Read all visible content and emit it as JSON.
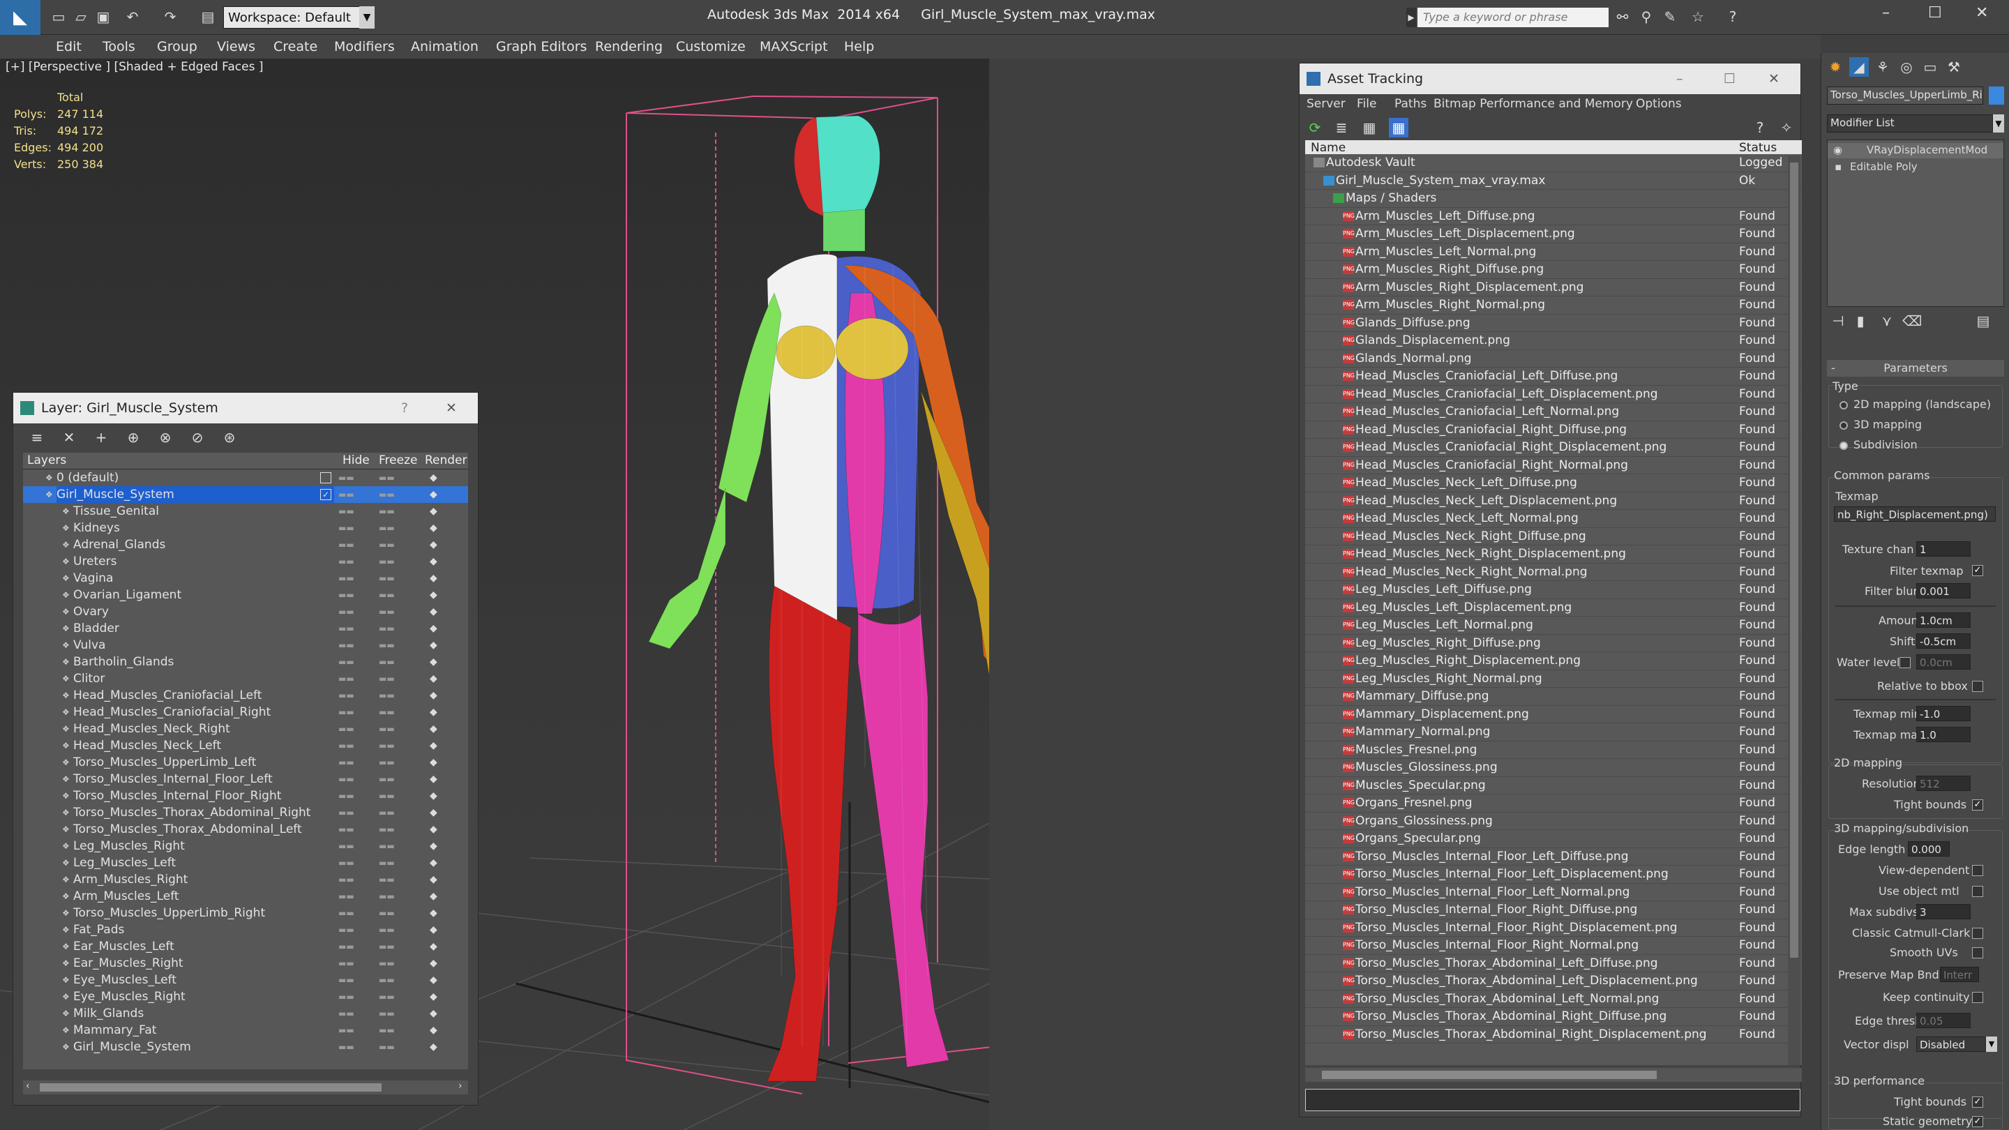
{
  "window": {
    "title": "Autodesk 3ds Max  2014 x64     Girl_Muscle_System_max_vray.max",
    "workspace": "Workspace: Default",
    "search_placeholder": "Type a keyword or phrase"
  },
  "menu": [
    "Edit",
    "Tools",
    "Group",
    "Views",
    "Create",
    "Modifiers",
    "Animation",
    "Graph Editors",
    "Rendering",
    "Customize",
    "MAXScript",
    "Help"
  ],
  "viewport": {
    "label": "[+] [Perspective ] [Shaded + Edged Faces ]",
    "stats": {
      "header": "Total",
      "rows": [
        {
          "label": "Polys:",
          "value": "247 114"
        },
        {
          "label": "Tris:",
          "value": "494 172"
        },
        {
          "label": "Edges:",
          "value": "494 200"
        },
        {
          "label": "Verts:",
          "value": "250 384"
        }
      ]
    }
  },
  "layer_panel": {
    "title": "Layer: Girl_Muscle_System",
    "columns": [
      "Layers",
      "Hide",
      "Freeze",
      "Render"
    ],
    "default_layer": "0 (default)",
    "active_layer": "Girl_Muscle_System",
    "layers": [
      "Tissue_Genital",
      "Kidneys",
      "Adrenal_Glands",
      "Ureters",
      "Vagina",
      "Ovarian_Ligament",
      "Ovary",
      "Bladder",
      "Vulva",
      "Bartholin_Glands",
      "Clitor",
      "Head_Muscles_Craniofacial_Left",
      "Head_Muscles_Craniofacial_Right",
      "Head_Muscles_Neck_Right",
      "Head_Muscles_Neck_Left",
      "Torso_Muscles_UpperLimb_Left",
      "Torso_Muscles_Internal_Floor_Left",
      "Torso_Muscles_Internal_Floor_Right",
      "Torso_Muscles_Thorax_Abdominal_Right",
      "Torso_Muscles_Thorax_Abdominal_Left",
      "Leg_Muscles_Right",
      "Leg_Muscles_Left",
      "Arm_Muscles_Right",
      "Arm_Muscles_Left",
      "Torso_Muscles_UpperLimb_Right",
      "Fat_Pads",
      "Ear_Muscles_Left",
      "Ear_Muscles_Right",
      "Eye_Muscles_Left",
      "Eye_Muscles_Right",
      "Milk_Glands",
      "Mammary_Fat",
      "Girl_Muscle_System"
    ]
  },
  "asset_panel": {
    "title": "Asset Tracking",
    "menu": [
      "Server",
      "File",
      "Paths",
      "Bitmap Performance and Memory",
      "Options"
    ],
    "columns": [
      "Name",
      "Status"
    ],
    "vault": {
      "name": "Autodesk Vault",
      "status": "Logged"
    },
    "file": {
      "name": "Girl_Muscle_System_max_vray.max",
      "status": "Ok"
    },
    "group": "Maps / Shaders",
    "found_label": "Found",
    "png_label": "PNG",
    "maps": [
      "Arm_Muscles_Left_Diffuse.png",
      "Arm_Muscles_Left_Displacement.png",
      "Arm_Muscles_Left_Normal.png",
      "Arm_Muscles_Right_Diffuse.png",
      "Arm_Muscles_Right_Displacement.png",
      "Arm_Muscles_Right_Normal.png",
      "Glands_Diffuse.png",
      "Glands_Displacement.png",
      "Glands_Normal.png",
      "Head_Muscles_Craniofacial_Left_Diffuse.png",
      "Head_Muscles_Craniofacial_Left_Displacement.png",
      "Head_Muscles_Craniofacial_Left_Normal.png",
      "Head_Muscles_Craniofacial_Right_Diffuse.png",
      "Head_Muscles_Craniofacial_Right_Displacement.png",
      "Head_Muscles_Craniofacial_Right_Normal.png",
      "Head_Muscles_Neck_Left_Diffuse.png",
      "Head_Muscles_Neck_Left_Displacement.png",
      "Head_Muscles_Neck_Left_Normal.png",
      "Head_Muscles_Neck_Right_Diffuse.png",
      "Head_Muscles_Neck_Right_Displacement.png",
      "Head_Muscles_Neck_Right_Normal.png",
      "Leg_Muscles_Left_Diffuse.png",
      "Leg_Muscles_Left_Displacement.png",
      "Leg_Muscles_Left_Normal.png",
      "Leg_Muscles_Right_Diffuse.png",
      "Leg_Muscles_Right_Displacement.png",
      "Leg_Muscles_Right_Normal.png",
      "Mammary_Diffuse.png",
      "Mammary_Displacement.png",
      "Mammary_Normal.png",
      "Muscles_Fresnel.png",
      "Muscles_Glossiness.png",
      "Muscles_Specular.png",
      "Organs_Fresnel.png",
      "Organs_Glossiness.png",
      "Organs_Specular.png",
      "Torso_Muscles_Internal_Floor_Left_Diffuse.png",
      "Torso_Muscles_Internal_Floor_Left_Displacement.png",
      "Torso_Muscles_Internal_Floor_Left_Normal.png",
      "Torso_Muscles_Internal_Floor_Right_Diffuse.png",
      "Torso_Muscles_Internal_Floor_Right_Displacement.png",
      "Torso_Muscles_Internal_Floor_Right_Normal.png",
      "Torso_Muscles_Thorax_Abdominal_Left_Diffuse.png",
      "Torso_Muscles_Thorax_Abdominal_Left_Displacement.png",
      "Torso_Muscles_Thorax_Abdominal_Left_Normal.png",
      "Torso_Muscles_Thorax_Abdominal_Right_Diffuse.png",
      "Torso_Muscles_Thorax_Abdominal_Right_Displacement.png"
    ]
  },
  "command_panel": {
    "object_name": "Torso_Muscles_UpperLimb_Ri",
    "modifier_list": "Modifier List",
    "stack": [
      "VRayDisplacementMod",
      "Editable Poly"
    ],
    "rollout": "Parameters",
    "type_label": "Type",
    "types": [
      "2D mapping (landscape)",
      "3D mapping",
      "Subdivision"
    ],
    "common": "Common params",
    "texmap_label": "Texmap",
    "texmap_value": "nb_Right_Displacement.png)",
    "fields": [
      {
        "label": "Texture chan",
        "value": "1"
      },
      {
        "label": "Filter texmap",
        "value": ""
      },
      {
        "label": "Filter blur",
        "value": "0.001"
      },
      {
        "label": "Amount",
        "value": "1.0cm"
      },
      {
        "label": "Shift",
        "value": "-0.5cm"
      },
      {
        "label": "Water level",
        "value": "0.0cm"
      },
      {
        "label": "Relative to bbox",
        "value": ""
      },
      {
        "label": "Texmap min",
        "value": "-1.0"
      },
      {
        "label": "Texmap max",
        "value": "1.0"
      }
    ],
    "mapping2d": "2D mapping",
    "resolution_label": "Resolution",
    "resolution_value": "512",
    "tight_bounds": "Tight bounds",
    "mapping3d": "3D mapping/subdivision",
    "edge_length_label": "Edge length",
    "edge_length_value": "0.000",
    "checks3d": [
      "View-dependent",
      "Use object mtl"
    ],
    "max_subdivs_label": "Max subdivs",
    "max_subdivs_value": "3",
    "checks3d_b": [
      "Classic Catmull-Clark",
      "Smooth UVs"
    ],
    "preserve_label": "Preserve Map Bnd",
    "preserve_value": "Interr",
    "keep_continuity": "Keep continuity",
    "edge_thresh_label": "Edge thresh",
    "edge_thresh_value": "0.05",
    "vector_disp_label": "Vector displ",
    "vector_disp_value": "Disabled",
    "perf": "3D performance",
    "perf_checks": [
      "Tight bounds",
      "Static geometry"
    ]
  },
  "colors": {
    "accent": "#1e5fd0",
    "selection": "#3374d6",
    "wire_box": "#e0508a"
  }
}
